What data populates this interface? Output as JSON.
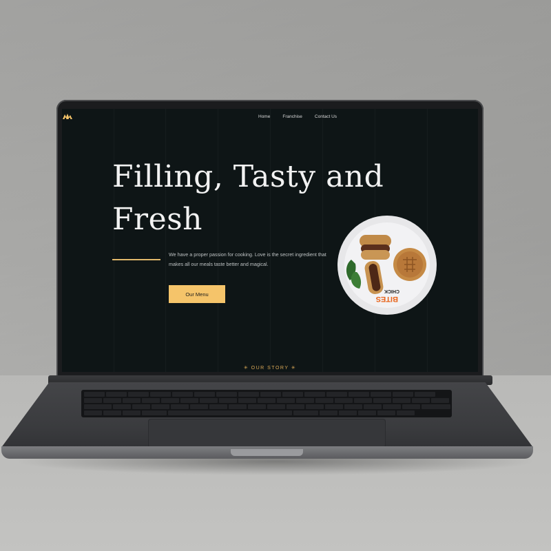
{
  "nav": {
    "items": [
      "Home",
      "Franchise",
      "Contact Us"
    ]
  },
  "hero": {
    "headline_line1": "Filling, Tasty and",
    "headline_line2": "Fresh",
    "description": "We have a proper passion for cooking. Love is the secret ingredient that makes all our meals taste better and magical.",
    "button_label": "Our Menu"
  },
  "next_section": {
    "label": "✳  OUR STORY  ✳"
  },
  "plate": {
    "brand_line1": "BITES",
    "brand_line2": "CHICK"
  },
  "colors": {
    "background": "#0e1516",
    "accent": "#f5c46a",
    "text": "#f2f2f2"
  },
  "icons": [
    "logo-icon"
  ]
}
